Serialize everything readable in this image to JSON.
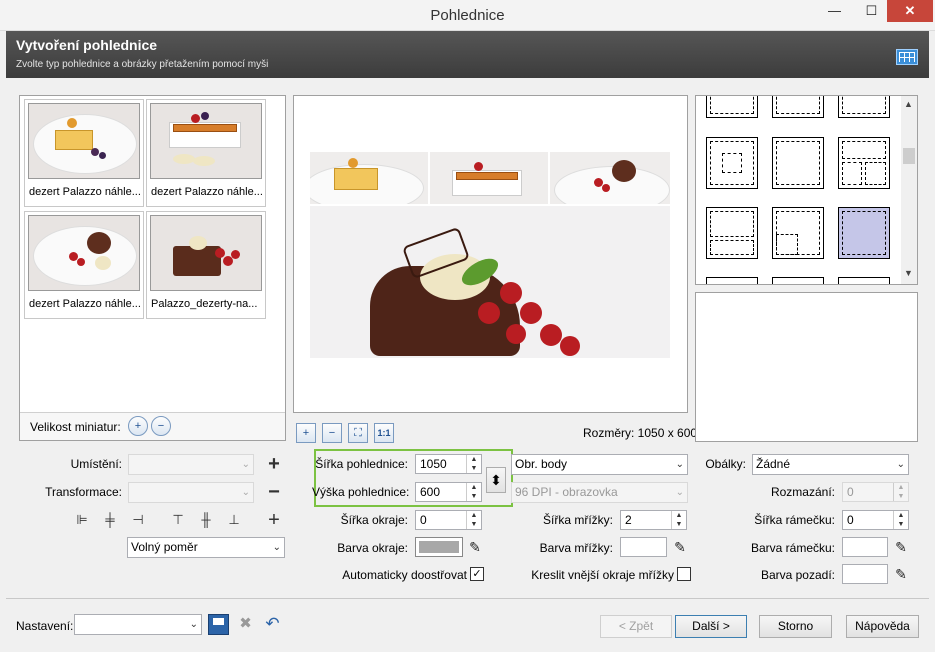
{
  "window": {
    "title": "Pohlednice",
    "minimize": "—",
    "maximize": "☐",
    "close": "✕"
  },
  "header": {
    "title": "Vytvoření pohlednice",
    "subtitle": "Zvolte typ pohlednice a obrázky přetažením pomocí myši"
  },
  "thumbnails": [
    {
      "label": "dezert Palazzo náhle..."
    },
    {
      "label": "dezert Palazzo náhle..."
    },
    {
      "label": "dezert Palazzo náhle..."
    },
    {
      "label": "Palazzo_dezerty-na..."
    }
  ],
  "thumbnail_size": {
    "label": "Velikost miniatur:",
    "zoom_in": "+",
    "zoom_out": "−"
  },
  "preview": {
    "dimensions": "Rozměry: 1050 x 600",
    "zoom_in": "+",
    "zoom_out": "−",
    "fit": "⛶",
    "actual": "1:1"
  },
  "left_controls": {
    "placement_label": "Umístění:",
    "placement_value": "",
    "transform_label": "Transformace:",
    "transform_value": "",
    "ratio_value": "Volný poměr",
    "add": "+",
    "remove": "−",
    "plus": "+"
  },
  "middle_controls": {
    "width_label": "Šířka pohlednice:",
    "width_value": "1050",
    "height_label": "Výška pohlednice:",
    "height_value": "600",
    "swap": "⬍",
    "border_width_label": "Šířka okraje:",
    "border_width_value": "0",
    "border_color_label": "Barva okraje:",
    "border_color": "#a8a8a8",
    "autofit_label": "Automaticky doostřovat",
    "autofit_checked": true
  },
  "units": {
    "unit_value": "Obr. body",
    "dpi_value": "96 DPI - obrazovka",
    "grid_width_label": "Šířka mřížky:",
    "grid_width_value": "2",
    "grid_color_label": "Barva mřížky:",
    "grid_color": "#ffffff",
    "outer_edges_label": "Kreslit vnější okraje mřížky",
    "outer_edges_checked": false
  },
  "right_controls": {
    "envelope_label": "Obálky:",
    "envelope_value": "Žádné",
    "blur_label": "Rozmazání:",
    "blur_value": "0",
    "frame_width_label": "Šířka rámečku:",
    "frame_width_value": "0",
    "frame_color_label": "Barva rámečku:",
    "frame_color": "#ffffff",
    "bg_color_label": "Barva pozadí:",
    "bg_color": "#ffffff"
  },
  "footer": {
    "settings_label": "Nastavení:",
    "settings_value": "",
    "back": "< Zpět",
    "next": "Další >",
    "cancel": "Storno",
    "help": "Nápověda"
  },
  "colors": {
    "highlight_green": "#7cc242",
    "selected_template": "#c5c6e8"
  }
}
